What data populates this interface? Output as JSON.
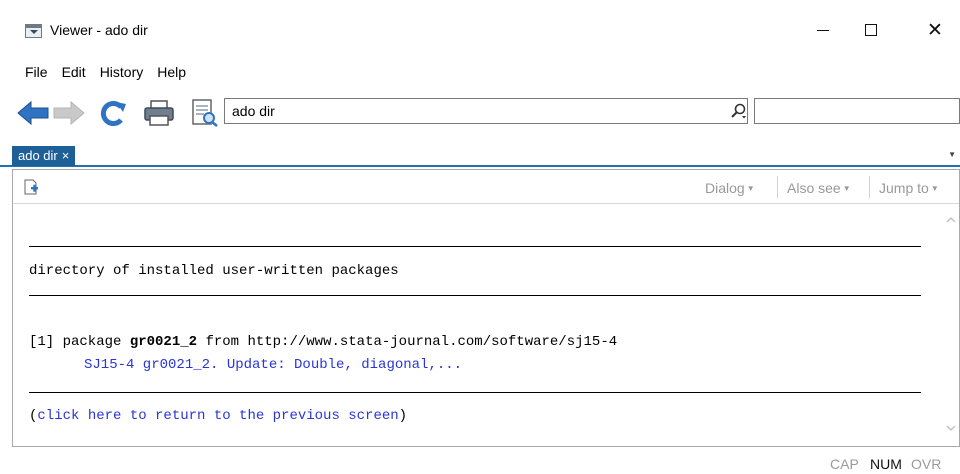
{
  "window": {
    "title": "Viewer - ado dir"
  },
  "menu": [
    "File",
    "Edit",
    "History",
    "Help"
  ],
  "toolbar": {
    "address_value": "ado dir"
  },
  "tabs": [
    {
      "label": "ado dir",
      "close": "×"
    }
  ],
  "viewer_menus": [
    "Dialog",
    "Also see",
    "Jump to"
  ],
  "content": {
    "heading": "directory of installed user-written packages",
    "package_prefix": "[1] package ",
    "package_name": "gr0021_2",
    "package_source": " from http://www.stata-journal.com/software/sj15-4",
    "package_desc": "SJ15-4 gr0021_2. Update: Double, diagonal,...",
    "return_open": "(",
    "return_link": "click here to return to the previous screen",
    "return_close": ")"
  },
  "status": {
    "cap": "CAP",
    "num": "NUM",
    "ovr": "OVR"
  },
  "colors": {
    "tab_bg": "#1d5f97",
    "link": "#2a35d6",
    "arrow_back": "#2f74c3",
    "refresh": "#2f74c3"
  }
}
